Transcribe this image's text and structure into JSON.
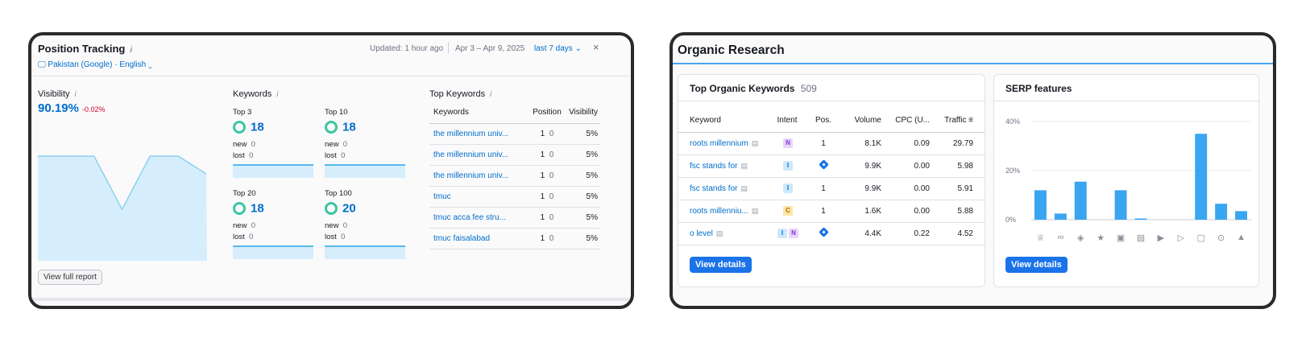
{
  "position_tracking": {
    "title": "Position Tracking",
    "info_icon": "info-icon",
    "updated": "Updated: 1 hour ago",
    "date_range": "Apr 3 – Apr 9, 2025",
    "period": "last 7 days",
    "location": "Pakistan (Google) · English",
    "visibility": {
      "label": "Visibility",
      "value": "90.19%",
      "change": "-0.02%"
    },
    "keywords": {
      "label": "Keywords",
      "groups": [
        {
          "label": "Top 3",
          "value": "18",
          "new_label": "new",
          "new": "0",
          "lost_label": "lost",
          "lost": "0"
        },
        {
          "label": "Top 10",
          "value": "18",
          "new_label": "new",
          "new": "0",
          "lost_label": "lost",
          "lost": "0"
        },
        {
          "label": "Top 20",
          "value": "18",
          "new_label": "new",
          "new": "0",
          "lost_label": "lost",
          "lost": "0"
        },
        {
          "label": "Top 100",
          "value": "20",
          "new_label": "new",
          "new": "0",
          "lost_label": "lost",
          "lost": "0"
        }
      ]
    },
    "top_keywords": {
      "label": "Top Keywords",
      "columns": [
        "Keywords",
        "Position",
        "Visibility"
      ],
      "rows": [
        {
          "keyword": "the millennium univ...",
          "pos": "1",
          "change": "0",
          "vis": "5%"
        },
        {
          "keyword": "the millennium univ...",
          "pos": "1",
          "change": "0",
          "vis": "5%"
        },
        {
          "keyword": "the millennium univ...",
          "pos": "1",
          "change": "0",
          "vis": "5%"
        },
        {
          "keyword": "tmuc",
          "pos": "1",
          "change": "0",
          "vis": "5%"
        },
        {
          "keyword": "tmuc acca fee stru...",
          "pos": "1",
          "change": "0",
          "vis": "5%"
        },
        {
          "keyword": "tmuc faisalabad",
          "pos": "1",
          "change": "0",
          "vis": "5%"
        }
      ]
    },
    "view_full_report": "View full report"
  },
  "organic_research": {
    "title": "Organic Research",
    "top_keywords": {
      "label": "Top Organic Keywords",
      "count": "509",
      "columns": [
        "Keyword",
        "Intent",
        "Pos.",
        "Volume",
        "CPC (U...",
        "Traffic"
      ],
      "rows": [
        {
          "keyword": "roots millennium",
          "intent": [
            "N"
          ],
          "pos": "1",
          "volume": "8.1K",
          "cpc": "0.09",
          "traffic": "29.79"
        },
        {
          "keyword": "fsc stands for",
          "intent": [
            "I"
          ],
          "pos": "diamond",
          "volume": "9.9K",
          "cpc": "0.00",
          "traffic": "5.98"
        },
        {
          "keyword": "fsc stands for",
          "intent": [
            "I"
          ],
          "pos": "1",
          "volume": "9.9K",
          "cpc": "0.00",
          "traffic": "5.91"
        },
        {
          "keyword": "roots millenniu...",
          "intent": [
            "C"
          ],
          "pos": "1",
          "volume": "1.6K",
          "cpc": "0.00",
          "traffic": "5.88"
        },
        {
          "keyword": "o level",
          "intent": [
            "I",
            "N"
          ],
          "pos": "diamond",
          "volume": "4.4K",
          "cpc": "0.22",
          "traffic": "4.52"
        }
      ],
      "view_details": "View details"
    },
    "serp": {
      "label": "SERP features",
      "view_details": "View details",
      "icons": [
        "crown-icon",
        "link-icon",
        "diamond-icon",
        "star-icon",
        "image-icon",
        "gallery-icon",
        "video-icon",
        "play-icon",
        "comment-icon",
        "pin-icon",
        "graduation-icon"
      ],
      "icon_glyphs": [
        "♕",
        "∞",
        "◈",
        "★",
        "▣",
        "▤",
        "▶",
        "▷",
        "▢",
        "⊙",
        "▲"
      ]
    }
  },
  "chart_data": [
    {
      "type": "area",
      "title": "Visibility",
      "x": [
        1,
        2,
        3,
        4,
        5,
        6,
        7
      ],
      "values": [
        90.2,
        90.2,
        90.2,
        90.17,
        90.2,
        90.2,
        90.19
      ],
      "color": "#8ccff2"
    },
    {
      "type": "bar",
      "title": "SERP features",
      "categories": [
        "crown",
        "link",
        "diamond",
        "star",
        "image",
        "gallery",
        "video",
        "play",
        "comment",
        "pin",
        "graduation"
      ],
      "values": [
        12,
        2.5,
        15.5,
        0,
        12,
        0.5,
        0,
        0,
        35,
        6.5,
        3.5
      ],
      "ytick_labels": [
        "40%",
        "20%",
        "0%"
      ],
      "ylim": [
        0,
        40
      ],
      "color": "#3aa5f0"
    }
  ]
}
